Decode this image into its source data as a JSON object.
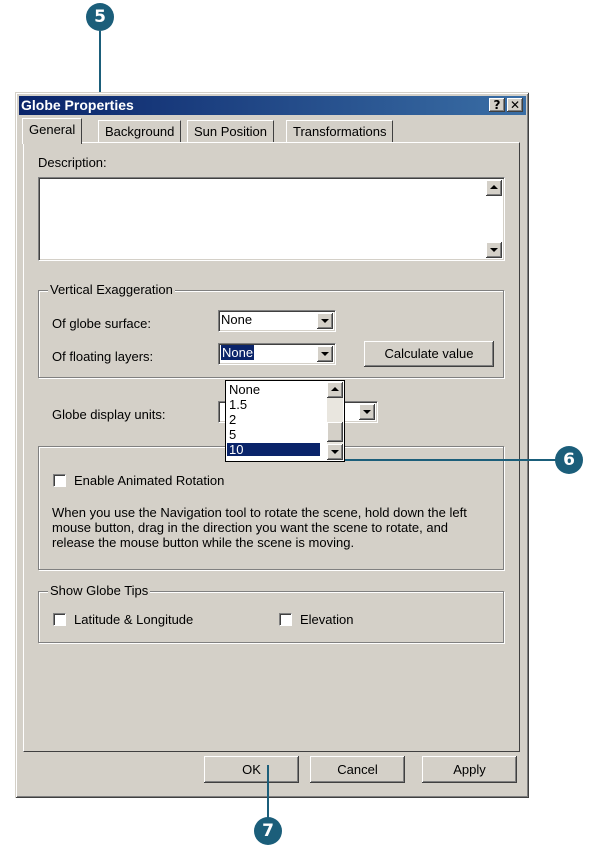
{
  "callouts": {
    "five": "5",
    "six": "6",
    "seven": "7"
  },
  "window": {
    "title": "Globe Properties",
    "help_label": "?",
    "close_label": "✕"
  },
  "tabs": [
    {
      "label": "General",
      "active": true
    },
    {
      "label": "Background"
    },
    {
      "label": "Sun Position"
    },
    {
      "label": "Transformations"
    }
  ],
  "general": {
    "description_label": "Description:",
    "description_value": "",
    "vertical_exaggeration": {
      "legend": "Vertical Exaggeration",
      "surface_label": "Of globe surface:",
      "surface_value": "None",
      "floating_label": "Of floating layers:",
      "floating_value": "None",
      "calculate_label": "Calculate value"
    },
    "dropdown_options": [
      "None",
      "1.5",
      "2",
      "5",
      "10"
    ],
    "dropdown_selected": "10",
    "display_units_label": "Globe display units:",
    "animated_rotation": {
      "label": "Enable Animated Rotation",
      "checked": false,
      "help_text": "When you use the Navigation tool to rotate the scene, hold down the left mouse button, drag in the direction you want the scene to rotate, and release the mouse button while the scene is moving."
    },
    "globe_tips": {
      "legend": "Show Globe Tips",
      "lat_long_label": "Latitude & Longitude",
      "elevation_label": "Elevation"
    }
  },
  "buttons": {
    "ok": "OK",
    "cancel": "Cancel",
    "apply": "Apply"
  },
  "colors": {
    "callout": "#1b5e7a",
    "titlebar": "#0a246a",
    "face": "#d4d0c8"
  }
}
